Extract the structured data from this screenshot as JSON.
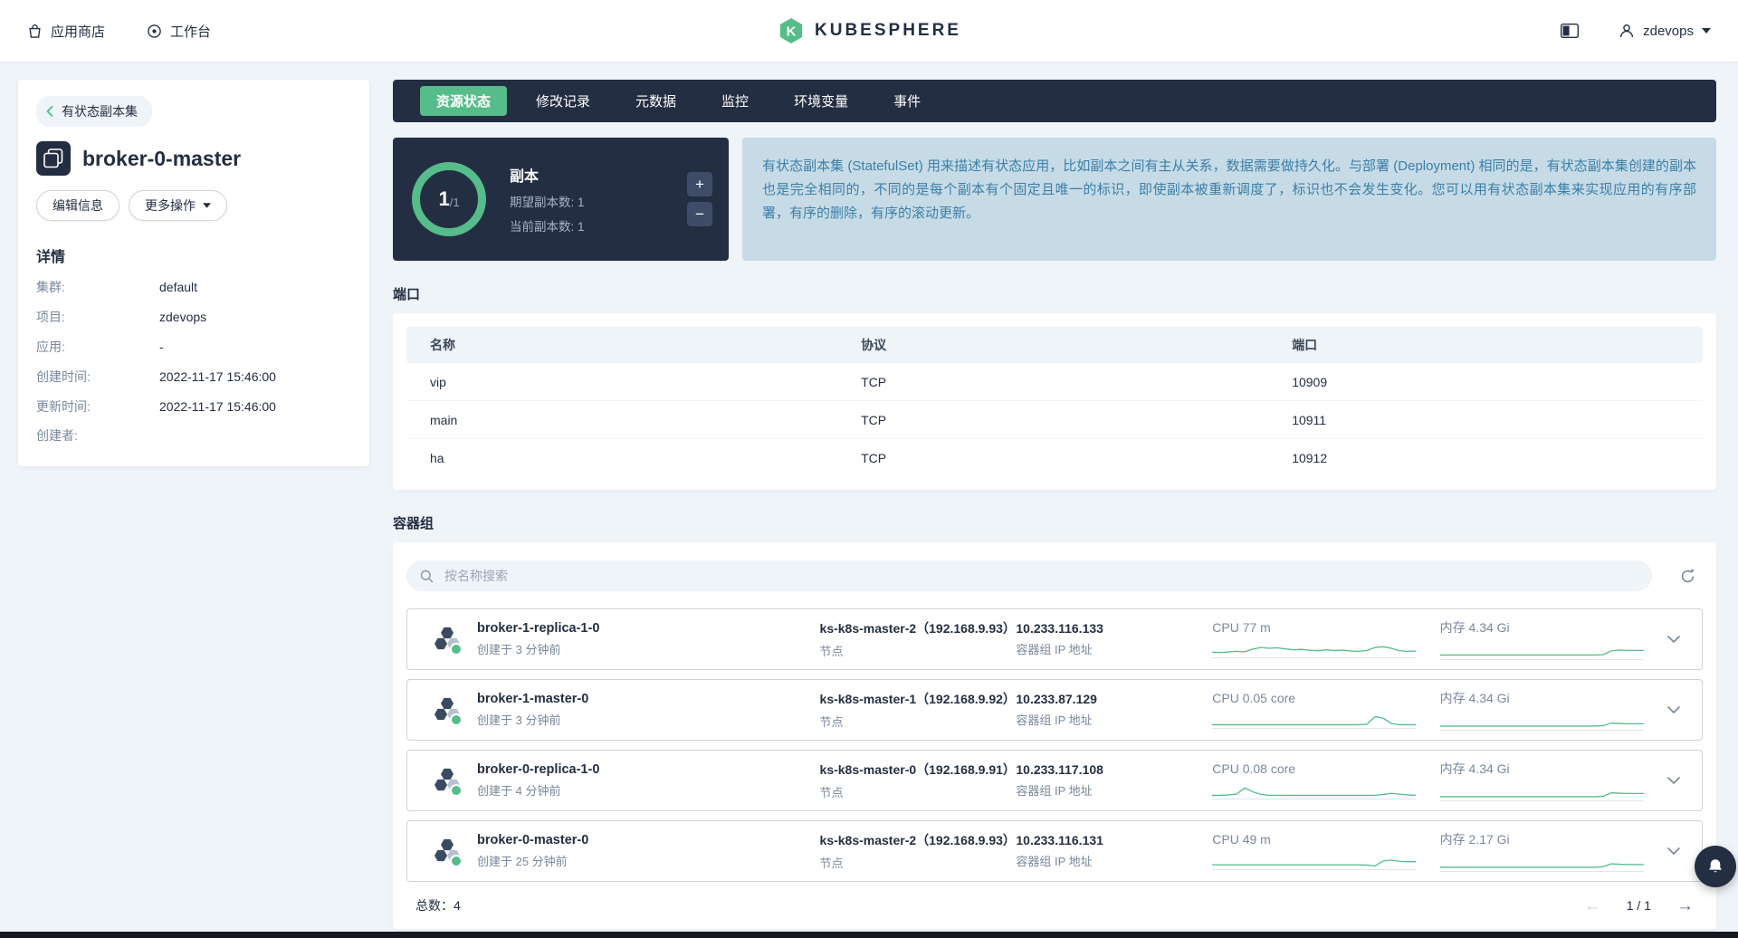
{
  "navbar": {
    "app_store": "应用商店",
    "workbench": "工作台",
    "logo_text": "KUBESPHERE",
    "user": "zdevops"
  },
  "sidebar": {
    "back_label": "有状态副本集",
    "title": "broker-0-master",
    "edit_button": "编辑信息",
    "more_button": "更多操作",
    "details_title": "详情",
    "details": [
      {
        "label": "集群:",
        "value": "default"
      },
      {
        "label": "项目:",
        "value": "zdevops"
      },
      {
        "label": "应用:",
        "value": "-"
      },
      {
        "label": "创建时间:",
        "value": "2022-11-17 15:46:00"
      },
      {
        "label": "更新时间:",
        "value": "2022-11-17 15:46:00"
      },
      {
        "label": "创建者:",
        "value": ""
      }
    ]
  },
  "tabs": [
    {
      "label": "资源状态",
      "active": true
    },
    {
      "label": "修改记录",
      "active": false
    },
    {
      "label": "元数据",
      "active": false
    },
    {
      "label": "监控",
      "active": false
    },
    {
      "label": "环境变量",
      "active": false
    },
    {
      "label": "事件",
      "active": false
    }
  ],
  "replica": {
    "count_main": "1",
    "count_suffix": "/1",
    "label": "副本",
    "desired": "期望副本数: 1",
    "current": "当前副本数: 1",
    "increase": "+",
    "decrease": "−"
  },
  "info_tip": "有状态副本集 (StatefulSet) 用来描述有状态应用，比如副本之间有主从关系，数据需要做持久化。与部署 (Deployment) 相同的是，有状态副本集创建的副本也是完全相同的，不同的是每个副本有个固定且唯一的标识，即使副本被重新调度了，标识也不会发生变化。您可以用有状态副本集来实现应用的有序部署，有序的删除，有序的滚动更新。",
  "ports": {
    "title": "端口",
    "headers": [
      "名称",
      "协议",
      "端口"
    ],
    "rows": [
      {
        "name": "vip",
        "protocol": "TCP",
        "port": "10909"
      },
      {
        "name": "main",
        "protocol": "TCP",
        "port": "10911"
      },
      {
        "name": "ha",
        "protocol": "TCP",
        "port": "10912"
      }
    ]
  },
  "pods": {
    "title": "容器组",
    "search_placeholder": "按名称搜索",
    "items": [
      {
        "name": "broker-1-replica-1-0",
        "created": "创建于 3 分钟前",
        "node": "ks-k8s-master-2（192.168.9.93）",
        "node_label": "节点",
        "ip": "10.233.116.133",
        "ip_label": "容器组 IP 地址",
        "cpu": "CPU 77 m",
        "memory": "内存 4.34 Gi",
        "cpu_spark": [
          0.25,
          0.22,
          0.26,
          0.3,
          0.27,
          0.45,
          0.55,
          0.5,
          0.53,
          0.46,
          0.4,
          0.43,
          0.37,
          0.34,
          0.4,
          0.35,
          0.38,
          0.32,
          0.3,
          0.36,
          0.55,
          0.6,
          0.5,
          0.34,
          0.3,
          0.32
        ],
        "mem_spark": [
          0.18,
          0.18,
          0.18,
          0.18,
          0.18,
          0.18,
          0.18,
          0.18,
          0.18,
          0.18,
          0.18,
          0.18,
          0.18,
          0.18,
          0.18,
          0.18,
          0.18,
          0.18,
          0.18,
          0.18,
          0.2,
          0.45,
          0.5,
          0.48,
          0.48,
          0.48
        ]
      },
      {
        "name": "broker-1-master-0",
        "created": "创建于 3 分钟前",
        "node": "ks-k8s-master-1（192.168.9.92）",
        "node_label": "节点",
        "ip": "10.233.87.129",
        "ip_label": "容器组 IP 地址",
        "cpu": "CPU 0.05 core",
        "memory": "内存 4.34 Gi",
        "cpu_spark": [
          0.12,
          0.12,
          0.12,
          0.12,
          0.12,
          0.12,
          0.12,
          0.12,
          0.12,
          0.12,
          0.12,
          0.12,
          0.12,
          0.12,
          0.12,
          0.12,
          0.12,
          0.12,
          0.12,
          0.15,
          0.65,
          0.55,
          0.2,
          0.12,
          0.12,
          0.12
        ],
        "mem_spark": [
          0.15,
          0.15,
          0.15,
          0.15,
          0.15,
          0.15,
          0.15,
          0.15,
          0.15,
          0.15,
          0.15,
          0.15,
          0.15,
          0.15,
          0.15,
          0.15,
          0.15,
          0.15,
          0.15,
          0.15,
          0.18,
          0.35,
          0.32,
          0.3,
          0.3,
          0.3
        ]
      },
      {
        "name": "broker-0-replica-1-0",
        "created": "创建于 4 分钟前",
        "node": "ks-k8s-master-0（192.168.9.91）",
        "node_label": "节点",
        "ip": "10.233.117.108",
        "ip_label": "容器组 IP 地址",
        "cpu": "CPU 0.08 core",
        "memory": "内存 4.34 Gi",
        "cpu_spark": [
          0.12,
          0.12,
          0.15,
          0.2,
          0.6,
          0.35,
          0.18,
          0.12,
          0.12,
          0.12,
          0.12,
          0.12,
          0.12,
          0.12,
          0.12,
          0.12,
          0.12,
          0.12,
          0.12,
          0.12,
          0.12,
          0.18,
          0.25,
          0.2,
          0.15,
          0.12
        ],
        "mem_spark": [
          0.15,
          0.15,
          0.15,
          0.15,
          0.15,
          0.15,
          0.15,
          0.15,
          0.15,
          0.15,
          0.15,
          0.15,
          0.15,
          0.15,
          0.15,
          0.15,
          0.15,
          0.15,
          0.15,
          0.15,
          0.18,
          0.4,
          0.38,
          0.36,
          0.36,
          0.36
        ]
      },
      {
        "name": "broker-0-master-0",
        "created": "创建于 25 分钟前",
        "node": "ks-k8s-master-2（192.168.9.93）",
        "node_label": "节点",
        "ip": "10.233.116.131",
        "ip_label": "容器组 IP 地址",
        "cpu": "CPU 49 m",
        "memory": "内存 2.17 Gi",
        "cpu_spark": [
          0.2,
          0.2,
          0.2,
          0.2,
          0.2,
          0.2,
          0.2,
          0.2,
          0.2,
          0.2,
          0.2,
          0.2,
          0.2,
          0.2,
          0.2,
          0.2,
          0.2,
          0.2,
          0.2,
          0.18,
          0.12,
          0.45,
          0.5,
          0.42,
          0.4,
          0.4
        ],
        "mem_spark": [
          0.15,
          0.15,
          0.15,
          0.15,
          0.15,
          0.15,
          0.15,
          0.15,
          0.15,
          0.15,
          0.15,
          0.15,
          0.15,
          0.15,
          0.15,
          0.15,
          0.15,
          0.15,
          0.15,
          0.15,
          0.2,
          0.38,
          0.35,
          0.33,
          0.33,
          0.33
        ]
      }
    ],
    "total": "总数：4",
    "page": "1 / 1"
  },
  "icons": {
    "prev_arrow": "←",
    "next_arrow": "→"
  },
  "colors": {
    "accent_green": "#55bc8a",
    "dark_navy": "#242e42",
    "page_bg": "#eff4f9",
    "info_bg": "#c7dbe6",
    "info_text": "#3b7fa8"
  }
}
